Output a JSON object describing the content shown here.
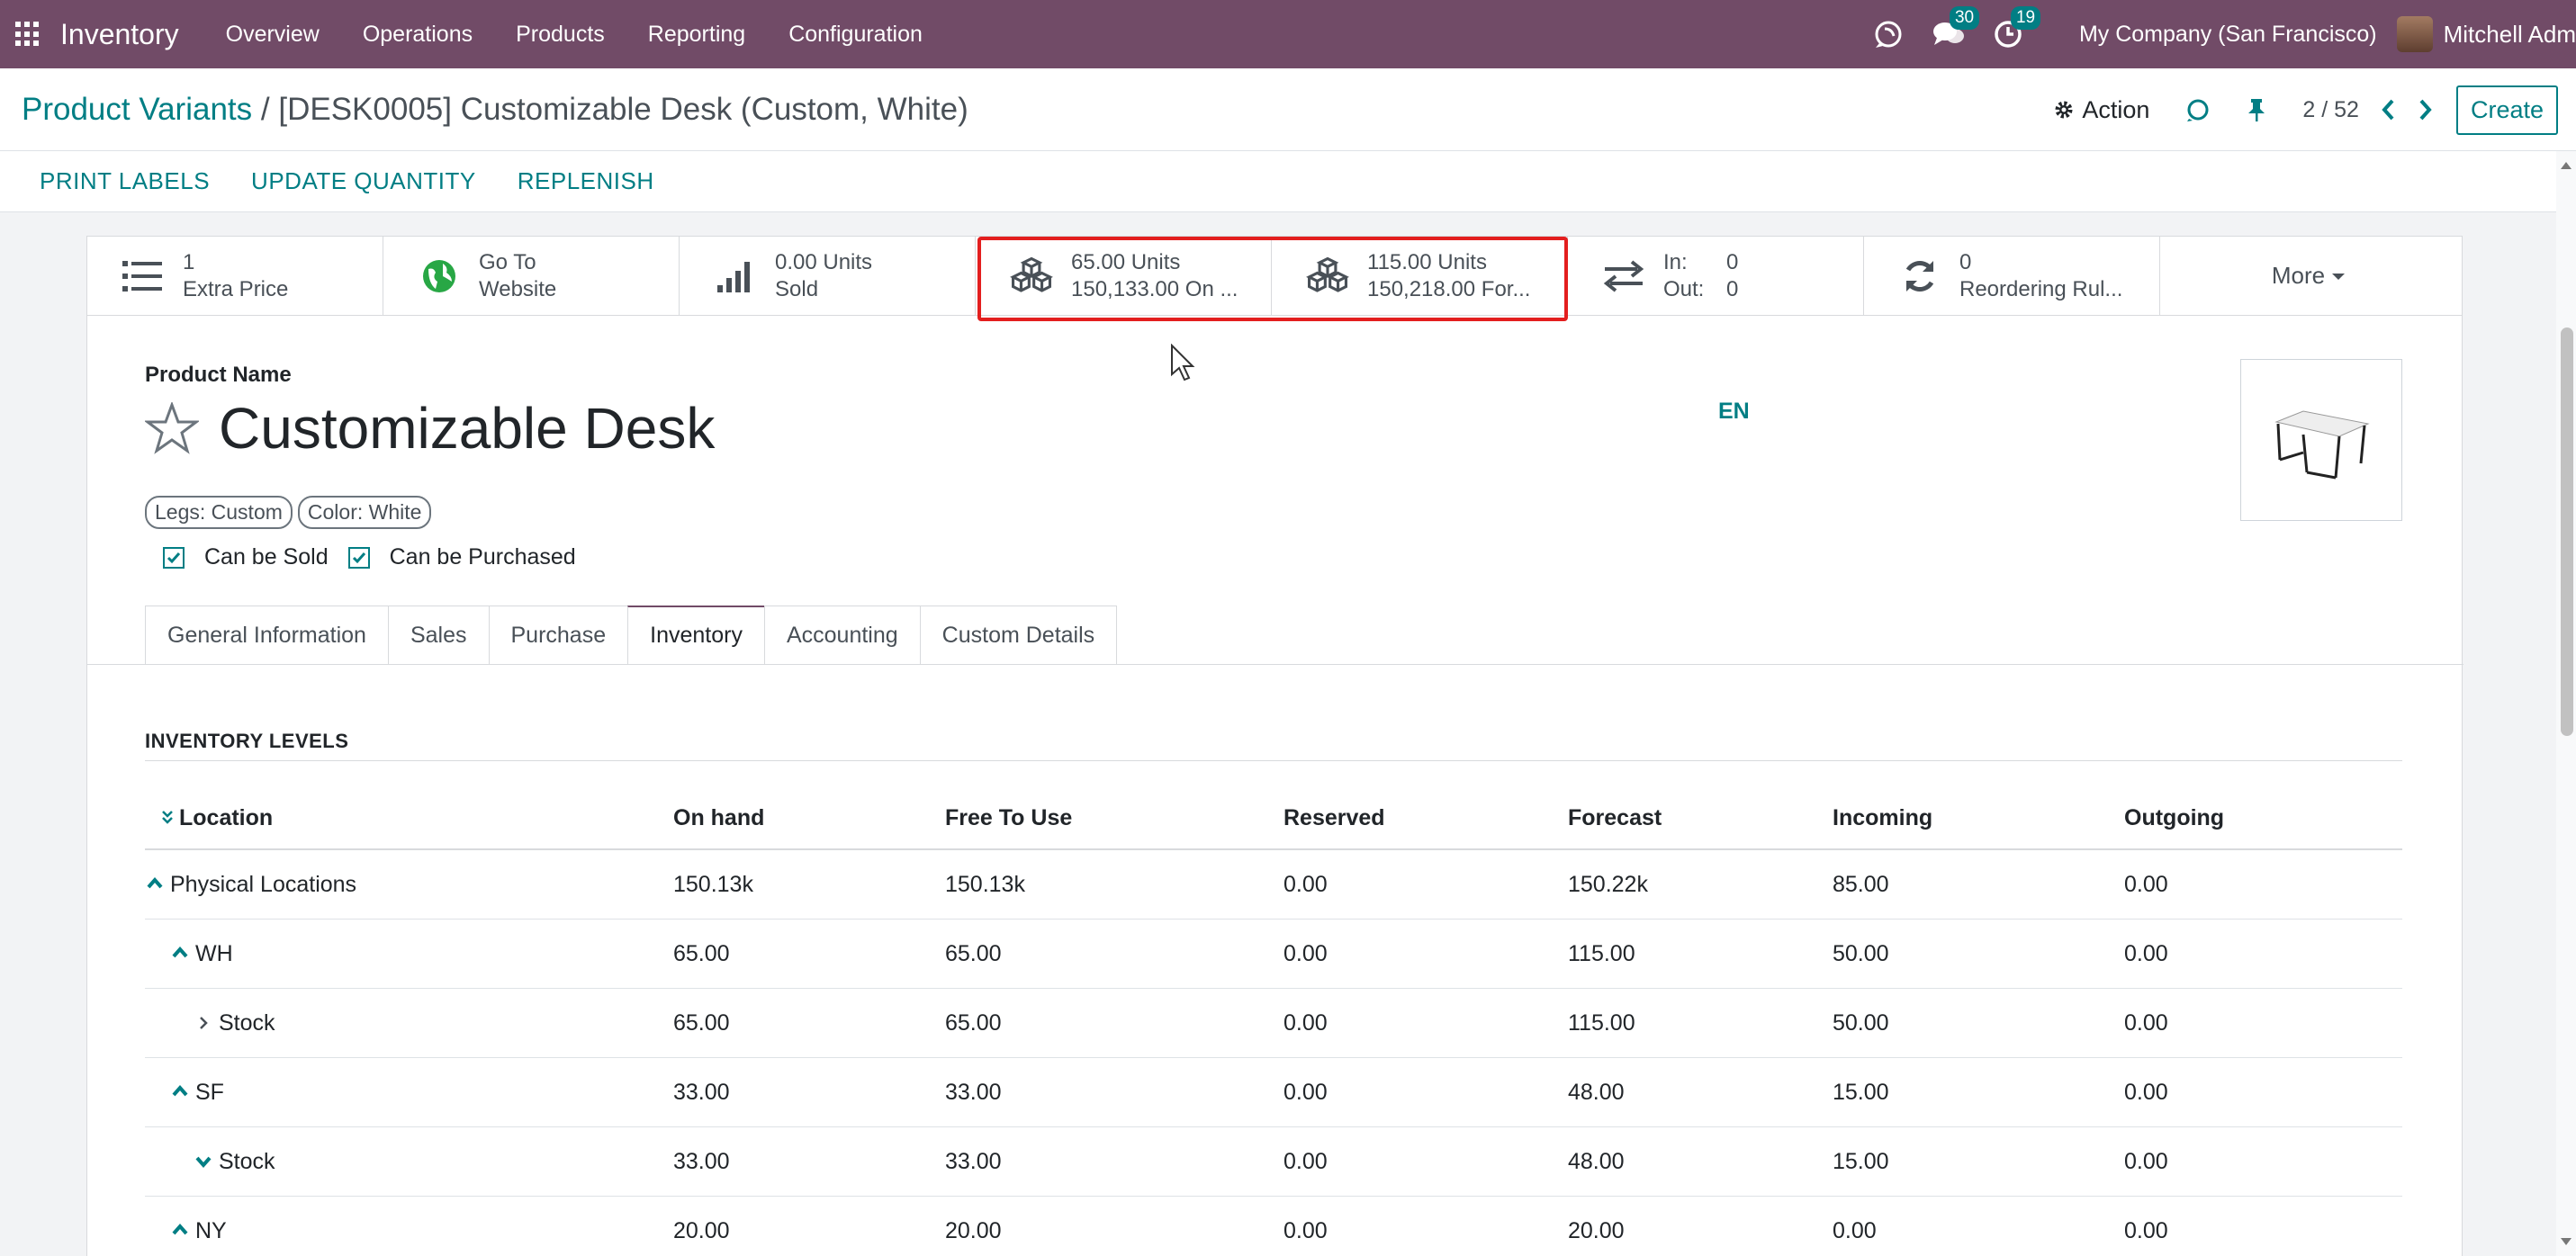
{
  "navbar": {
    "brand": "Inventory",
    "menu": [
      "Overview",
      "Operations",
      "Products",
      "Reporting",
      "Configuration"
    ],
    "messages_count": "30",
    "activities_count": "19",
    "company": "My Company (San Francisco)",
    "user": "Mitchell Adm"
  },
  "control_panel": {
    "breadcrumb_parent": "Product Variants",
    "breadcrumb_sep": "/",
    "breadcrumb_current": "[DESK0005] Customizable Desk (Custom, White)",
    "action_label": "Action",
    "pager": "2 / 52",
    "create_label": "Create"
  },
  "status_actions": [
    "PRINT LABELS",
    "UPDATE QUANTITY",
    "REPLENISH"
  ],
  "smart_buttons": {
    "extra_price": {
      "value": "1",
      "label": "Extra Price"
    },
    "website": {
      "value": "Go To",
      "label": "Website"
    },
    "sold": {
      "value": "0.00 Units",
      "label": "Sold"
    },
    "on_hand": {
      "value": "65.00 Units",
      "label": "150,133.00 On ..."
    },
    "forecast": {
      "value": "115.00 Units",
      "label": "150,218.00 For..."
    },
    "in_out": {
      "in_label": "In:",
      "in_value": "0",
      "out_label": "Out:",
      "out_value": "0"
    },
    "reordering": {
      "value": "0",
      "label": "Reordering Rul..."
    },
    "more": "More"
  },
  "form": {
    "product_name_label": "Product Name",
    "product_name": "Customizable Desk",
    "lang": "EN",
    "tags": [
      "Legs: Custom",
      "Color: White"
    ],
    "can_be_sold": "Can be Sold",
    "can_be_purchased": "Can be Purchased"
  },
  "tabs": [
    "General Information",
    "Sales",
    "Purchase",
    "Inventory",
    "Accounting",
    "Custom Details"
  ],
  "active_tab": "Inventory",
  "inventory": {
    "section_title": "INVENTORY LEVELS",
    "columns": [
      "Location",
      "On hand",
      "Free To Use",
      "Reserved",
      "Forecast",
      "Incoming",
      "Outgoing"
    ],
    "rows": [
      {
        "location": "Physical Locations",
        "level": 0,
        "expander": "up",
        "on_hand": "150.13k",
        "free": "150.13k",
        "reserved": "0.00",
        "forecast": "150.22k",
        "incoming": "85.00",
        "outgoing": "0.00"
      },
      {
        "location": "WH",
        "level": 1,
        "expander": "up",
        "on_hand": "65.00",
        "free": "65.00",
        "reserved": "0.00",
        "forecast": "115.00",
        "incoming": "50.00",
        "outgoing": "0.00"
      },
      {
        "location": "Stock",
        "level": 2,
        "expander": "right",
        "on_hand": "65.00",
        "free": "65.00",
        "reserved": "0.00",
        "forecast": "115.00",
        "incoming": "50.00",
        "outgoing": "0.00"
      },
      {
        "location": "SF",
        "level": 1,
        "expander": "up",
        "on_hand": "33.00",
        "free": "33.00",
        "reserved": "0.00",
        "forecast": "48.00",
        "incoming": "15.00",
        "outgoing": "0.00"
      },
      {
        "location": "Stock",
        "level": 2,
        "expander": "down",
        "on_hand": "33.00",
        "free": "33.00",
        "reserved": "0.00",
        "forecast": "48.00",
        "incoming": "15.00",
        "outgoing": "0.00"
      },
      {
        "location": "NY",
        "level": 1,
        "expander": "up",
        "on_hand": "20.00",
        "free": "20.00",
        "reserved": "0.00",
        "forecast": "20.00",
        "incoming": "0.00",
        "outgoing": "0.00"
      }
    ]
  },
  "colors": {
    "navbar": "#714b67",
    "accent": "#017e84",
    "highlight": "#e31e1e"
  }
}
